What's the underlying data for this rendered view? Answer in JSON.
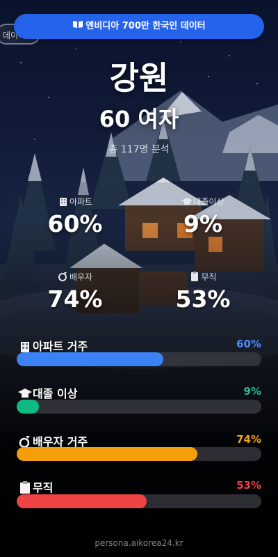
{
  "ghost_chip": "데이터",
  "banner": {
    "icon": "book-icon",
    "text": "엔비디아 700만 한국인 데이터"
  },
  "region": "강원",
  "subtitle": "60 여자",
  "total": "총 117명 분석",
  "stats": [
    {
      "icon": "apartment-icon",
      "label": "아파트",
      "value": "60%"
    },
    {
      "icon": "graduation-cap-icon",
      "label": "대졸이상",
      "value": "9%"
    },
    {
      "icon": "ring-icon",
      "label": "배우자",
      "value": "74%"
    },
    {
      "icon": "clipboard-icon",
      "label": "무직",
      "value": "53%"
    }
  ],
  "bars": [
    {
      "icon": "apartment-icon",
      "label": "아파트 거주",
      "percent_text": "60%",
      "fraction": 0.6,
      "color": "#3b82f6",
      "text_color": "#4f8df5"
    },
    {
      "icon": "graduation-cap-icon",
      "label": "대졸 이상",
      "percent_text": "9%",
      "fraction": 0.09,
      "color": "#10b981",
      "text_color": "#19c08a"
    },
    {
      "icon": "ring-icon",
      "label": "배우자 거주",
      "percent_text": "74%",
      "fraction": 0.74,
      "color": "#f59e0b",
      "text_color": "#f5a31a"
    },
    {
      "icon": "clipboard-icon",
      "label": "무직",
      "percent_text": "53%",
      "fraction": 0.53,
      "color": "#ef4444",
      "text_color": "#ef4444"
    }
  ],
  "footer": "persona.aikorea24.kr"
}
